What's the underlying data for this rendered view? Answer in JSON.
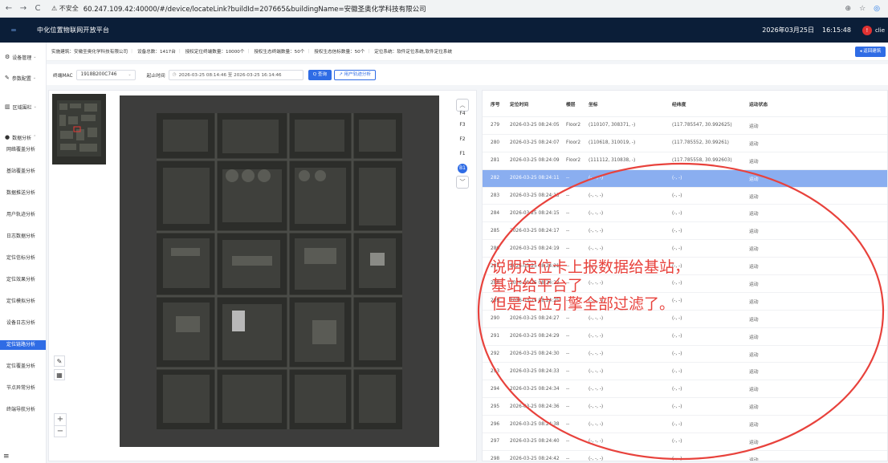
{
  "browser": {
    "back": "←",
    "forward": "→",
    "reload": "C",
    "insecure_label": "⚠ 不安全",
    "url": "60.247.109.42:40000/#/device/locateLink?buildId=207665&buildingName=安徽圣奥化学科技有限公司",
    "icons": [
      "zoom-icon",
      "star-icon",
      "account-icon"
    ]
  },
  "header": {
    "title": "中化位置物联网开放平台",
    "date": "2026年03月25日",
    "time": "16:15:48",
    "user": "clie"
  },
  "sidebar": {
    "groups": [
      {
        "label": "设备管理",
        "icon": "⚙",
        "items": []
      },
      {
        "label": "参数配置",
        "icon": "✎",
        "items": []
      },
      {
        "label": "区域围栏",
        "icon": "▥",
        "items": []
      },
      {
        "label": "数据分析",
        "icon": "●",
        "items": [
          "网络覆盖分析",
          "基站覆盖分析",
          "数据推送分析",
          "用户轨迹分析",
          "日志数据分析",
          "定位信标分析",
          "定位效果分析",
          "定位模拟分析",
          "设备日志分析",
          "定位链路分析",
          "定位覆盖分析",
          "节点异常分析",
          "终端导航分析"
        ]
      }
    ],
    "active_item": "定位链路分析",
    "footer_label": "设备分析",
    "menu_toggle": "≡"
  },
  "info_bar": {
    "segments": [
      "实施建筑：安徽圣奥化学科技有限公司",
      "设备总数：1417台",
      "授权定位终端数量：10000个",
      "授权生态终端数量：50个",
      "授权生态信标数量：50个",
      "定位系统：软件定位系统,软件定位系统"
    ],
    "back_button": "◂ 返回建筑"
  },
  "filters": {
    "mac_label": "终端MAC",
    "mac_value": "1918B200C746",
    "time_label": "起止时间",
    "time_value": "2026-03-25 08:14:46 至 2026-03-25 16:14:46",
    "query_button": "Q 查询",
    "track_button": "↗ 用户轨迹分析"
  },
  "map": {
    "floors": [
      "F4",
      "F3",
      "F2",
      "F1",
      "B1"
    ],
    "current_floor": "B1",
    "zoom_in": "+",
    "zoom_out": "−"
  },
  "table": {
    "columns": [
      "序号",
      "定位时间",
      "楼层",
      "坐标",
      "经纬度",
      "运动状态"
    ],
    "selected_index": 3,
    "rows": [
      [
        "279",
        "2026-03-25 08:24:05",
        "Floor2",
        "(110107, 308371, -)",
        "(117.785547, 30.992625)",
        "运动"
      ],
      [
        "280",
        "2026-03-25 08:24:07",
        "Floor2",
        "(110618, 310019, -)",
        "(117.785552, 30.99261)",
        "运动"
      ],
      [
        "281",
        "2026-03-25 08:24:09",
        "Floor2",
        "(111112, 310838, -)",
        "(117.785558, 30.992603)",
        "运动"
      ],
      [
        "282",
        "2026-03-25 08:24:11",
        "--",
        "(-, -, -)",
        "(-, -)",
        "运动"
      ],
      [
        "283",
        "2026-03-25 08:24:13",
        "--",
        "(-, -, -)",
        "(-, -)",
        "运动"
      ],
      [
        "284",
        "2026-03-25 08:24:15",
        "--",
        "(-, -, -)",
        "(-, -)",
        "运动"
      ],
      [
        "285",
        "2026-03-25 08:24:17",
        "--",
        "(-, -, -)",
        "(-, -)",
        "运动"
      ],
      [
        "286",
        "2026-03-25 08:24:19",
        "--",
        "(-, -, -)",
        "(-, -)",
        "运动"
      ],
      [
        "287",
        "2026-03-25 08:24:21",
        "--",
        "(-, -, -)",
        "(-, -)",
        "运动"
      ],
      [
        "288",
        "2026-03-25 08:24:23",
        "--",
        "(-, -, -)",
        "(-, -)",
        "运动"
      ],
      [
        "289",
        "2026-03-25 08:24:25",
        "--",
        "(-, -, -)",
        "(-, -)",
        "运动"
      ],
      [
        "290",
        "2026-03-25 08:24:27",
        "--",
        "(-, -, -)",
        "(-, -)",
        "运动"
      ],
      [
        "291",
        "2026-03-25 08:24:29",
        "--",
        "(-, -, -)",
        "(-, -)",
        "运动"
      ],
      [
        "292",
        "2026-03-25 08:24:30",
        "--",
        "(-, -, -)",
        "(-, -)",
        "运动"
      ],
      [
        "293",
        "2026-03-25 08:24:33",
        "--",
        "(-, -, -)",
        "(-, -)",
        "运动"
      ],
      [
        "294",
        "2026-03-25 08:24:34",
        "--",
        "(-, -, -)",
        "(-, -)",
        "运动"
      ],
      [
        "295",
        "2026-03-25 08:24:36",
        "--",
        "(-, -, -)",
        "(-, -)",
        "运动"
      ],
      [
        "296",
        "2026-03-25 08:24:38",
        "--",
        "(-, -, -)",
        "(-, -)",
        "运动"
      ],
      [
        "297",
        "2026-03-25 08:24:40",
        "--",
        "(-, -, -)",
        "(-, -)",
        "运动"
      ],
      [
        "298",
        "2026-03-25 08:24:42",
        "--",
        "(-, -, -)",
        "(-, -)",
        "运动"
      ]
    ]
  },
  "annotation": {
    "lines": [
      "说明定位卡上报数据给基站，",
      "基站给平台了",
      "但是定位引擎全部过滤了。"
    ],
    "color": "#e8423c"
  }
}
